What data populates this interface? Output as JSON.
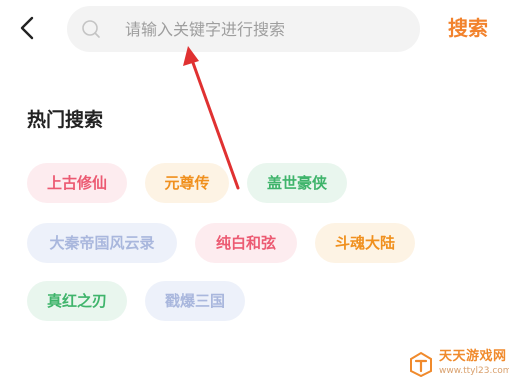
{
  "search": {
    "placeholder": "请输入关键字进行搜索",
    "button_label": "搜索"
  },
  "hot": {
    "title": "热门搜索",
    "tags": [
      {
        "label": "上古修仙",
        "color": "red"
      },
      {
        "label": "元尊传",
        "color": "orange"
      },
      {
        "label": "盖世豪侠",
        "color": "green"
      },
      {
        "label": "大秦帝国风云录",
        "color": "blue"
      },
      {
        "label": "纯白和弦",
        "color": "red"
      },
      {
        "label": "斗魂大陆",
        "color": "orange"
      },
      {
        "label": "真红之刃",
        "color": "green"
      },
      {
        "label": "戳爆三国",
        "color": "blue"
      }
    ]
  },
  "watermark": {
    "title": "天天游戏网",
    "url": "www.ttyl23.com"
  },
  "colors": {
    "accent": "#f2822c",
    "arrow": "#e03131"
  },
  "icons": {
    "back": "chevron-left-icon",
    "search": "search-icon"
  }
}
